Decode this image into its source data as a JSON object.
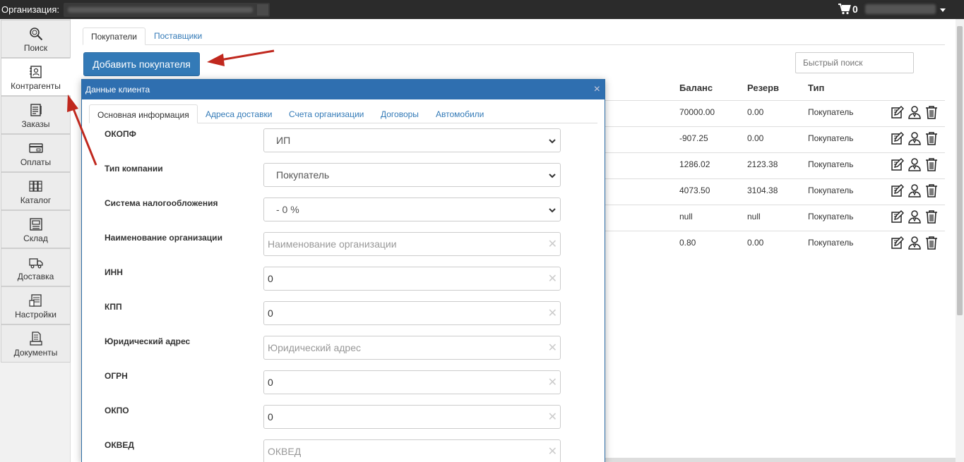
{
  "topbar": {
    "org_label": "Организация:",
    "cart_count": "0"
  },
  "sidebar": {
    "items": [
      {
        "label": "Поиск",
        "icon": "search-icon"
      },
      {
        "label": "Контрагенты",
        "icon": "contacts-icon"
      },
      {
        "label": "Заказы",
        "icon": "orders-icon"
      },
      {
        "label": "Оплаты",
        "icon": "payments-icon"
      },
      {
        "label": "Каталог",
        "icon": "catalog-icon"
      },
      {
        "label": "Склад",
        "icon": "warehouse-icon"
      },
      {
        "label": "Доставка",
        "icon": "delivery-icon"
      },
      {
        "label": "Настройки",
        "icon": "settings-icon"
      },
      {
        "label": "Документы",
        "icon": "documents-icon"
      }
    ],
    "active_index": 1
  },
  "main": {
    "tabs": [
      {
        "label": "Покупатели",
        "active": true
      },
      {
        "label": "Поставщики",
        "active": false
      }
    ],
    "add_button": "Добавить покупателя",
    "quick_search_placeholder": "Быстрый поиск",
    "table": {
      "headers": [
        "Баланс",
        "Резерв",
        "Тип"
      ],
      "rows": [
        {
          "balance": "70000.00",
          "reserve": "0.00",
          "type": "Покупатель"
        },
        {
          "balance": "-907.25",
          "reserve": "0.00",
          "type": "Покупатель"
        },
        {
          "balance": "1286.02",
          "reserve": "2123.38",
          "type": "Покупатель"
        },
        {
          "balance": "4073.50",
          "reserve": "3104.38",
          "type": "Покупатель"
        },
        {
          "balance": "null",
          "reserve": "null",
          "type": "Покупатель"
        },
        {
          "balance": "0.80",
          "reserve": "0.00",
          "type": "Покупатель"
        }
      ]
    }
  },
  "modal": {
    "title": "Данные клиента",
    "close": "×",
    "tabs": [
      {
        "label": "Основная информация",
        "active": true
      },
      {
        "label": "Адреса доставки",
        "active": false
      },
      {
        "label": "Счета организации",
        "active": false
      },
      {
        "label": "Договоры",
        "active": false
      },
      {
        "label": "Автомобили",
        "active": false
      }
    ],
    "fields": [
      {
        "label": "ОКОПФ",
        "kind": "select",
        "value": "ИП"
      },
      {
        "label": "Тип компании",
        "kind": "select",
        "value": "Покупатель"
      },
      {
        "label": "Система налогообложения",
        "kind": "select",
        "value": "- 0 %"
      },
      {
        "label": "Наименование организации",
        "kind": "input",
        "value": "",
        "placeholder": "Наименование организации"
      },
      {
        "label": "ИНН",
        "kind": "input",
        "value": "0",
        "placeholder": ""
      },
      {
        "label": "КПП",
        "kind": "input",
        "value": "0",
        "placeholder": ""
      },
      {
        "label": "Юридический адрес",
        "kind": "input",
        "value": "",
        "placeholder": "Юридический адрес"
      },
      {
        "label": "ОГРН",
        "kind": "input",
        "value": "0",
        "placeholder": ""
      },
      {
        "label": "ОКПО",
        "kind": "input",
        "value": "0",
        "placeholder": ""
      },
      {
        "label": "ОКВЕД",
        "kind": "input",
        "value": "",
        "placeholder": "ОКВЕД"
      }
    ]
  },
  "colors": {
    "primary": "#337ab7",
    "modal_header": "#2f6fb0",
    "topbar": "#2b2b2b",
    "annotation_arrow": "#c0281e"
  }
}
